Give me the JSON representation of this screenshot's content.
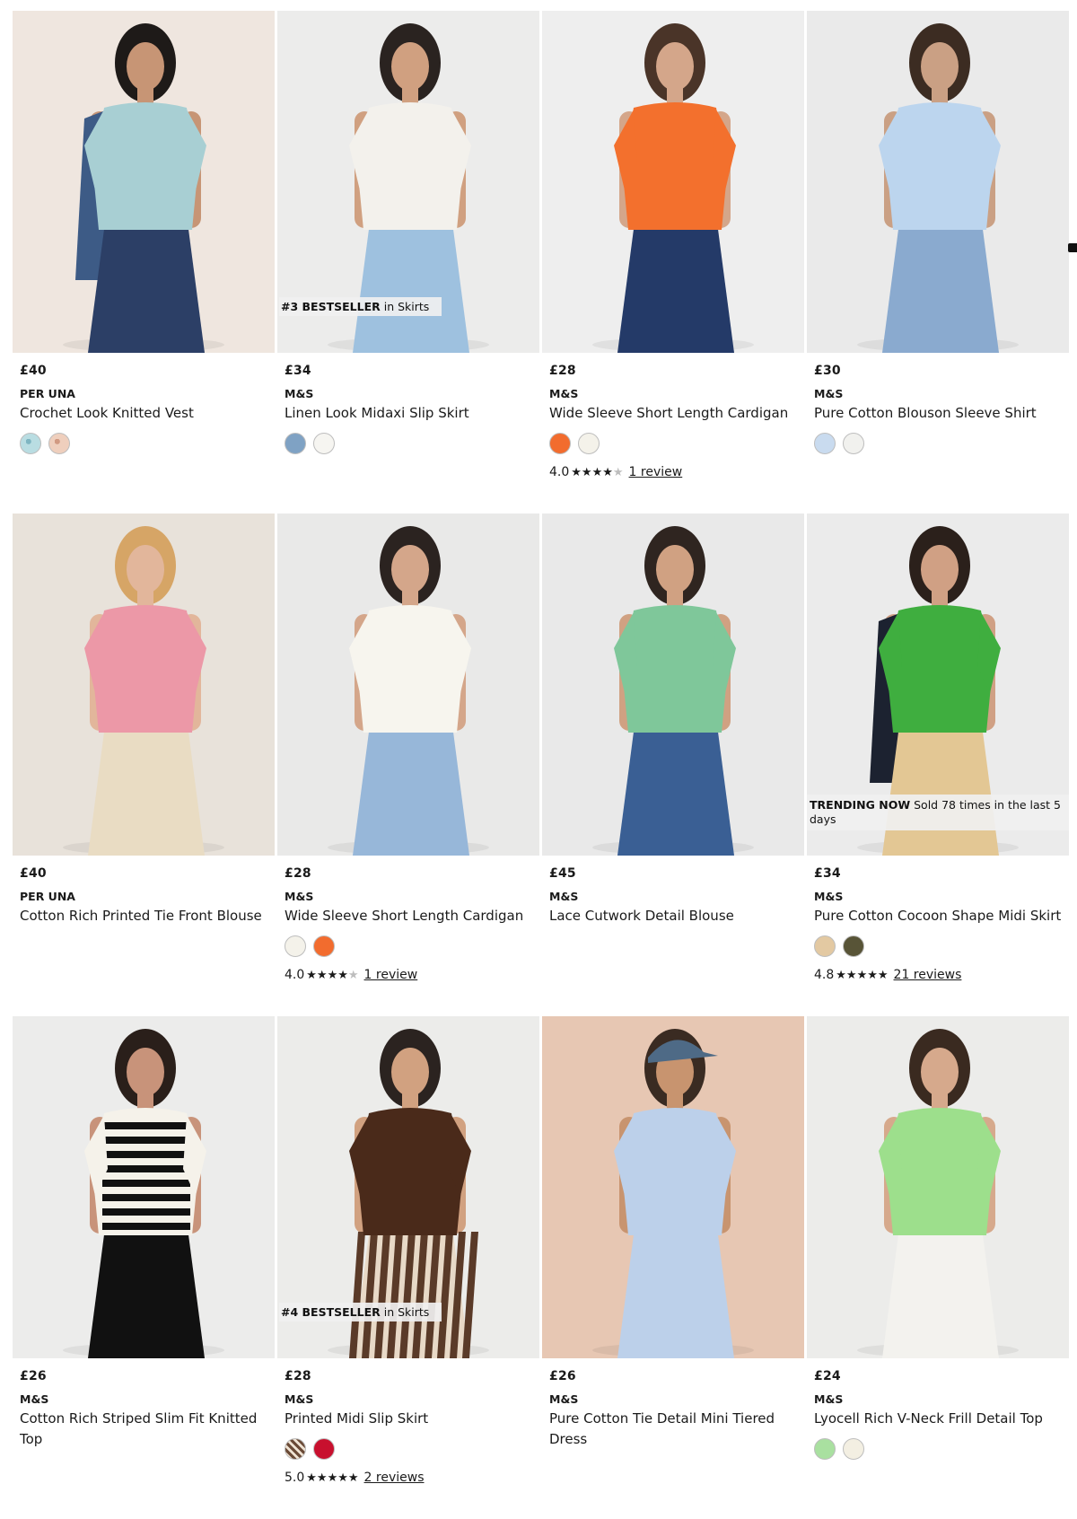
{
  "products": [
    {
      "price": "£40",
      "brand": "PER UNA",
      "title": "Crochet Look Knitted Vest",
      "badge": null,
      "swatches": [
        {
          "name": "blue-pattern",
          "color": "#a9d3da"
        },
        {
          "name": "peach-pattern",
          "color": "#e7c2ad"
        }
      ],
      "rating": null,
      "photo": {
        "bg": "#efe6df",
        "top": "#a8cfd3",
        "bottom": "#2c3f66",
        "skin": "#c79575",
        "hair": "#1e1a18",
        "jacket": "#3d5b86"
      }
    },
    {
      "price": "£34",
      "brand": "M&S",
      "title": "Linen Look Midaxi Slip Skirt",
      "badge": {
        "strong": "#3 BESTSELLER",
        "rest": " in Skirts"
      },
      "swatches": [
        {
          "name": "blue",
          "color": "#7fa2c4"
        },
        {
          "name": "white",
          "color": "#f6f5f1"
        }
      ],
      "rating": null,
      "photo": {
        "bg": "#ececeb",
        "top": "#f3f1ec",
        "bottom": "#9ec1df",
        "skin": "#d0a080",
        "hair": "#2a2320"
      }
    },
    {
      "price": "£28",
      "brand": "M&S",
      "title": "Wide Sleeve Short Length Cardigan",
      "badge": null,
      "swatches": [
        {
          "name": "orange",
          "color": "#f26c2e"
        },
        {
          "name": "cream",
          "color": "#f4f2ea"
        }
      ],
      "rating": {
        "score": "4.0",
        "stars": 4,
        "text": "1 review"
      },
      "photo": {
        "bg": "#eeeeee",
        "top": "#f3702d",
        "bottom": "#243a68",
        "skin": "#d4a68a",
        "hair": "#4a3428"
      }
    },
    {
      "price": "£30",
      "brand": "M&S",
      "title": "Pure Cotton Blouson Sleeve Shirt",
      "badge": null,
      "swatches": [
        {
          "name": "light-blue",
          "color": "#c9dbef"
        },
        {
          "name": "white",
          "color": "#f1f1ee"
        }
      ],
      "rating": null,
      "photo": {
        "bg": "#eaeaea",
        "top": "#bcd5ee",
        "bottom": "#8aaacf",
        "skin": "#caa084",
        "hair": "#3c2c22"
      }
    },
    {
      "price": "£40",
      "brand": "PER UNA",
      "title": "Cotton Rich Printed Tie Front Blouse",
      "badge": null,
      "swatches": [],
      "rating": null,
      "photo": {
        "bg": "#e8e2da",
        "top": "#ec98a7",
        "bottom": "#e9dcc3",
        "skin": "#e2b69b",
        "hair": "#d6a566"
      }
    },
    {
      "price": "£28",
      "brand": "M&S",
      "title": "Wide Sleeve Short Length Cardigan",
      "badge": null,
      "swatches": [
        {
          "name": "cream",
          "color": "#f4f2ea"
        },
        {
          "name": "orange",
          "color": "#f26c2e"
        }
      ],
      "rating": {
        "score": "4.0",
        "stars": 4,
        "text": "1 review"
      },
      "photo": {
        "bg": "#e9e9e8",
        "top": "#f7f5ee",
        "bottom": "#97b7d9",
        "skin": "#d4a68a",
        "hair": "#2b2320"
      }
    },
    {
      "price": "£45",
      "brand": "M&S",
      "title": "Lace Cutwork Detail Blouse",
      "badge": null,
      "swatches": [],
      "rating": null,
      "photo": {
        "bg": "#e9e9e9",
        "top": "#7fc79a",
        "bottom": "#3a5f94",
        "skin": "#d0a182",
        "hair": "#2f2520"
      }
    },
    {
      "price": "£34",
      "brand": "M&S",
      "title": "Pure Cotton Cocoon Shape Midi Skirt",
      "badge": {
        "strong": "TRENDING NOW",
        "rest": " Sold 78 times in the last 5 days",
        "trend": true
      },
      "swatches": [
        {
          "name": "sand",
          "color": "#e3c9a2"
        },
        {
          "name": "khaki",
          "color": "#585437"
        }
      ],
      "rating": {
        "score": "4.8",
        "stars": 5,
        "text": "21 reviews"
      },
      "photo": {
        "bg": "#ebebeb",
        "top": "#3fae3f",
        "bottom": "#e3c794",
        "skin": "#d0a084",
        "hair": "#2b201b",
        "jacket": "#1c2230"
      }
    },
    {
      "price": "£26",
      "brand": "M&S",
      "title": "Cotton Rich Striped Slim Fit Knitted Top",
      "badge": null,
      "swatches": [],
      "rating": null,
      "photo": {
        "bg": "#ececeb",
        "top": "#f5f2ea",
        "bottom": "#111111",
        "skin": "#c8937a",
        "hair": "#2a1f1a",
        "stripes": true
      }
    },
    {
      "price": "£28",
      "brand": "M&S",
      "title": "Printed Midi Slip Skirt",
      "badge": {
        "strong": "#4 BESTSELLER",
        "rest": " in Skirts"
      },
      "swatches": [
        {
          "name": "brown-stripe",
          "color": "#6a4a36"
        },
        {
          "name": "red",
          "color": "#c8102e"
        }
      ],
      "rating": {
        "score": "5.0",
        "stars": 5,
        "text": "2 reviews"
      },
      "photo": {
        "bg": "#ececea",
        "top": "#4a2a1a",
        "bottom": "#e8d9c7",
        "skin": "#d1a180",
        "hair": "#2b2320",
        "skirtstripes": true
      }
    },
    {
      "price": "£26",
      "brand": "M&S",
      "title": "Pure Cotton Tie Detail Mini Tiered Dress",
      "badge": null,
      "swatches": [],
      "rating": null,
      "photo": {
        "bg": "#e7c7b3",
        "top": "#bcd0ea",
        "bottom": "#bcd0ea",
        "skin": "#c8946f",
        "hair": "#3a2b22",
        "cap": "#4e6a86"
      }
    },
    {
      "price": "£24",
      "brand": "M&S",
      "title": "Lyocell Rich V-Neck Frill Detail Top",
      "badge": null,
      "swatches": [
        {
          "name": "light-green",
          "color": "#a9e0a0"
        },
        {
          "name": "ivory",
          "color": "#f3efe2"
        }
      ],
      "rating": null,
      "photo": {
        "bg": "#ececea",
        "top": "#9ddf8c",
        "bottom": "#f3f2ee",
        "skin": "#d6a98c",
        "hair": "#3a2a20"
      }
    }
  ]
}
